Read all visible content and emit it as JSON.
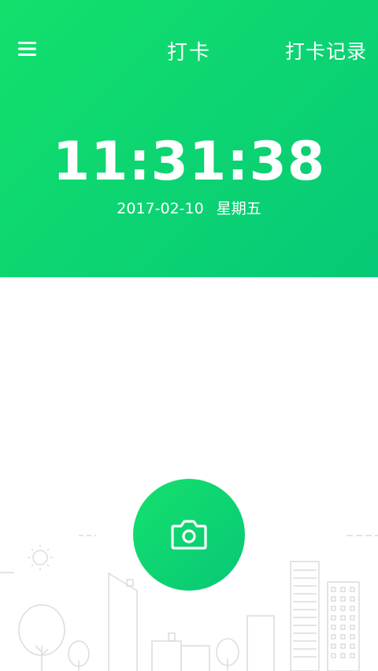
{
  "nav": {
    "menu_icon": "hamburger-menu-icon",
    "title": "打卡",
    "records_label": "打卡记录"
  },
  "clock": {
    "time": "11:31:38",
    "date": "2017-02-10",
    "weekday": "星期五"
  },
  "actions": {
    "camera_icon": "camera-icon"
  },
  "colors": {
    "brand_green": "#10d870",
    "line_art": "#d9d9d9"
  }
}
